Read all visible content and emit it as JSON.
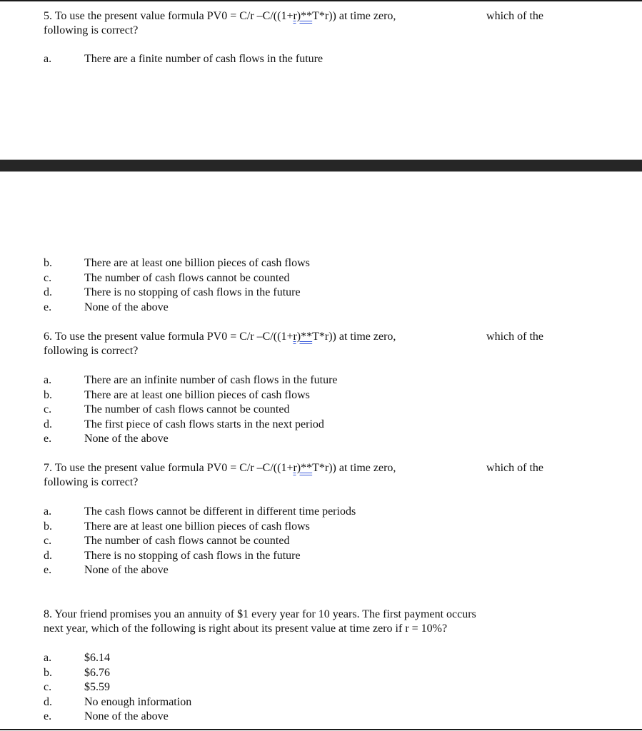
{
  "document": {
    "questions": [
      {
        "number": "5.",
        "line1_parts": [
          "To use the present value formula PV0 = C/r –C/((1+",
          "r)**",
          "T*r)) at time zero,",
          "which of the"
        ],
        "line2": "following is correct?",
        "options_before_break": [
          {
            "letter": "a.",
            "text": "There are a finite number of cash flows in the future"
          }
        ],
        "options_after_break": [
          {
            "letter": "b.",
            "text": "There are at least one billion pieces of cash flows"
          },
          {
            "letter": "c.",
            "text": "The number of cash flows cannot be counted"
          },
          {
            "letter": "d.",
            "text": "There is no stopping of cash flows in the future"
          },
          {
            "letter": "e.",
            "text": "None of the above"
          }
        ]
      },
      {
        "number": "6.",
        "line1_parts": [
          "To use the present value formula PV0 = C/r –C/((1+",
          "r)**",
          "T*r)) at time zero,",
          "which of the"
        ],
        "line2": "following is correct?",
        "options": [
          {
            "letter": "a.",
            "text": "There are an infinite number of cash flows in the future"
          },
          {
            "letter": "b.",
            "text": "There are at least one billion pieces of cash flows"
          },
          {
            "letter": "c.",
            "text": "The number of cash flows cannot be counted"
          },
          {
            "letter": "d.",
            "text": "The first piece of cash flows starts in the next period"
          },
          {
            "letter": "e.",
            "text": "None of the above"
          }
        ]
      },
      {
        "number": "7.",
        "line1_parts": [
          "To use the present value formula PV0 = C/r –C/((1+",
          "r)**",
          "T*r)) at time zero,",
          "which of the"
        ],
        "line2": "following is correct?",
        "options": [
          {
            "letter": "a.",
            "text": "The cash flows cannot be different in different time periods"
          },
          {
            "letter": "b.",
            "text": "There are at least one billion pieces of cash flows"
          },
          {
            "letter": "c.",
            "text": "The number of cash flows cannot be counted"
          },
          {
            "letter": "d.",
            "text": "There is no stopping of cash flows in the future"
          },
          {
            "letter": "e.",
            "text": "None of the above"
          }
        ]
      },
      {
        "number": "8.",
        "line1": "Your friend promises you an annuity of $1 every year for 10 years. The first payment occurs",
        "line2": "next year, which of the following is right about its present value at time zero if r = 10%?",
        "options": [
          {
            "letter": "a.",
            "text": "$6.14"
          },
          {
            "letter": "b.",
            "text": "$6.76"
          },
          {
            "letter": "c.",
            "text": "$5.59"
          },
          {
            "letter": "d.",
            "text": "No enough information"
          },
          {
            "letter": "e.",
            "text": "None of the above"
          }
        ]
      }
    ]
  },
  "colors": {
    "text": "#111111",
    "page_break": "#262626",
    "spellcheck_underline": "#3b5bdb"
  }
}
